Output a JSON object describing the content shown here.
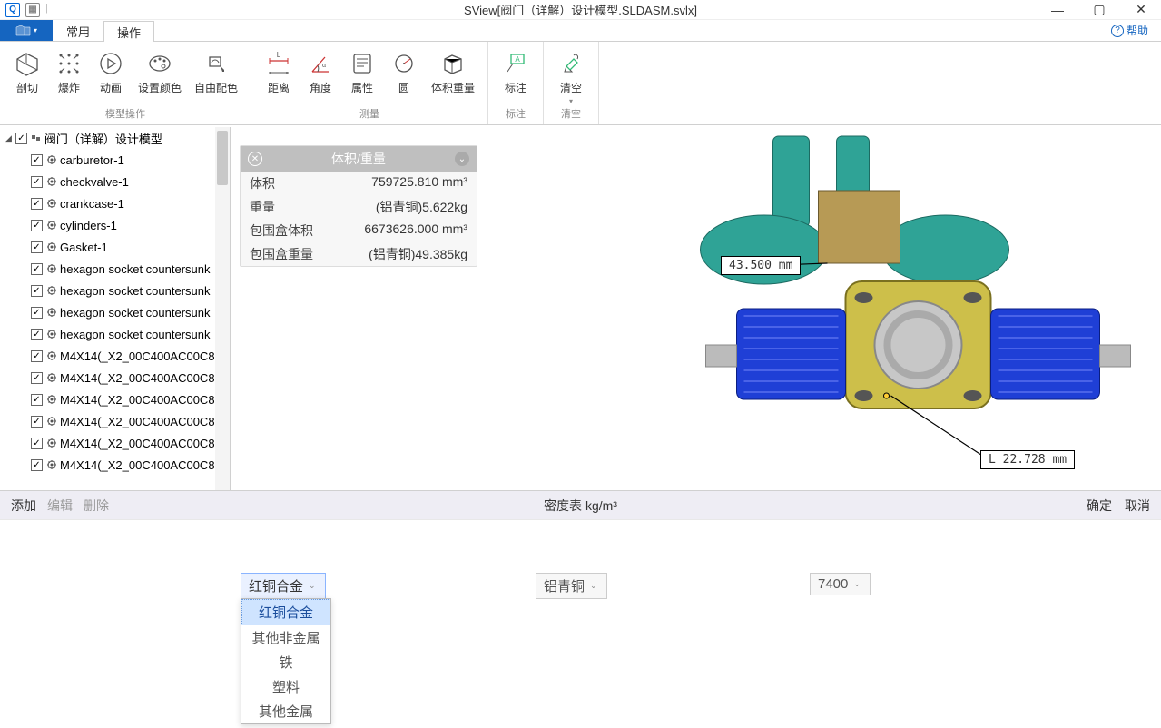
{
  "title": "SView[阀门（详解）设计模型.SLDASM.svlx]",
  "help": "帮助",
  "tabs": {
    "file": "",
    "common": "常用",
    "operate": "操作"
  },
  "ribbon": {
    "model_ops": {
      "name": "模型操作",
      "cut": "剖切",
      "explode": "爆炸",
      "anim": "动画",
      "color": "设置颜色",
      "autocolor": "自由配色"
    },
    "measure": {
      "name": "测量",
      "dist": "距离",
      "angle": "角度",
      "attr": "属性",
      "circle": "圆",
      "vw": "体积重量"
    },
    "annot": {
      "name": "标注",
      "annot": "标注"
    },
    "clear": {
      "name": "清空",
      "clear": "清空"
    }
  },
  "tree": {
    "root": "阀门（详解）设计模型",
    "items": [
      "carburetor-1",
      "checkvalve-1",
      "crankcase-1",
      "cylinders-1",
      "Gasket-1",
      "hexagon socket countersunk",
      "hexagon socket countersunk",
      "hexagon socket countersunk",
      "hexagon socket countersunk",
      "M4X14(_X2_00C400AC00C8",
      "M4X14(_X2_00C400AC00C8",
      "M4X14(_X2_00C400AC00C8",
      "M4X14(_X2_00C400AC00C8",
      "M4X14(_X2_00C400AC00C8",
      "M4X14(_X2_00C400AC00C8"
    ]
  },
  "vw": {
    "title": "体积/重量",
    "rows": {
      "vol_k": "体积",
      "vol_v": "759725.810 mm³",
      "wt_k": "重量",
      "wt_v": "(铝青铜)5.622kg",
      "bvol_k": "包围盒体积",
      "bvol_v": "6673626.000 mm³",
      "bwt_k": "包围盒重量",
      "bwt_v": "(铝青铜)49.385kg"
    }
  },
  "dims": {
    "a": "43.500 mm",
    "b": "L 22.728 mm"
  },
  "density": {
    "add": "添加",
    "edit": "编辑",
    "del": "删除",
    "title": "密度表 kg/m³",
    "ok": "确定",
    "cancel": "取消",
    "sel1": "红铜合金",
    "sel2": "铝青铜",
    "sel3": "7400",
    "options": [
      "红铜合金",
      "其他非金属",
      "铁",
      "塑料",
      "其他金属"
    ]
  }
}
